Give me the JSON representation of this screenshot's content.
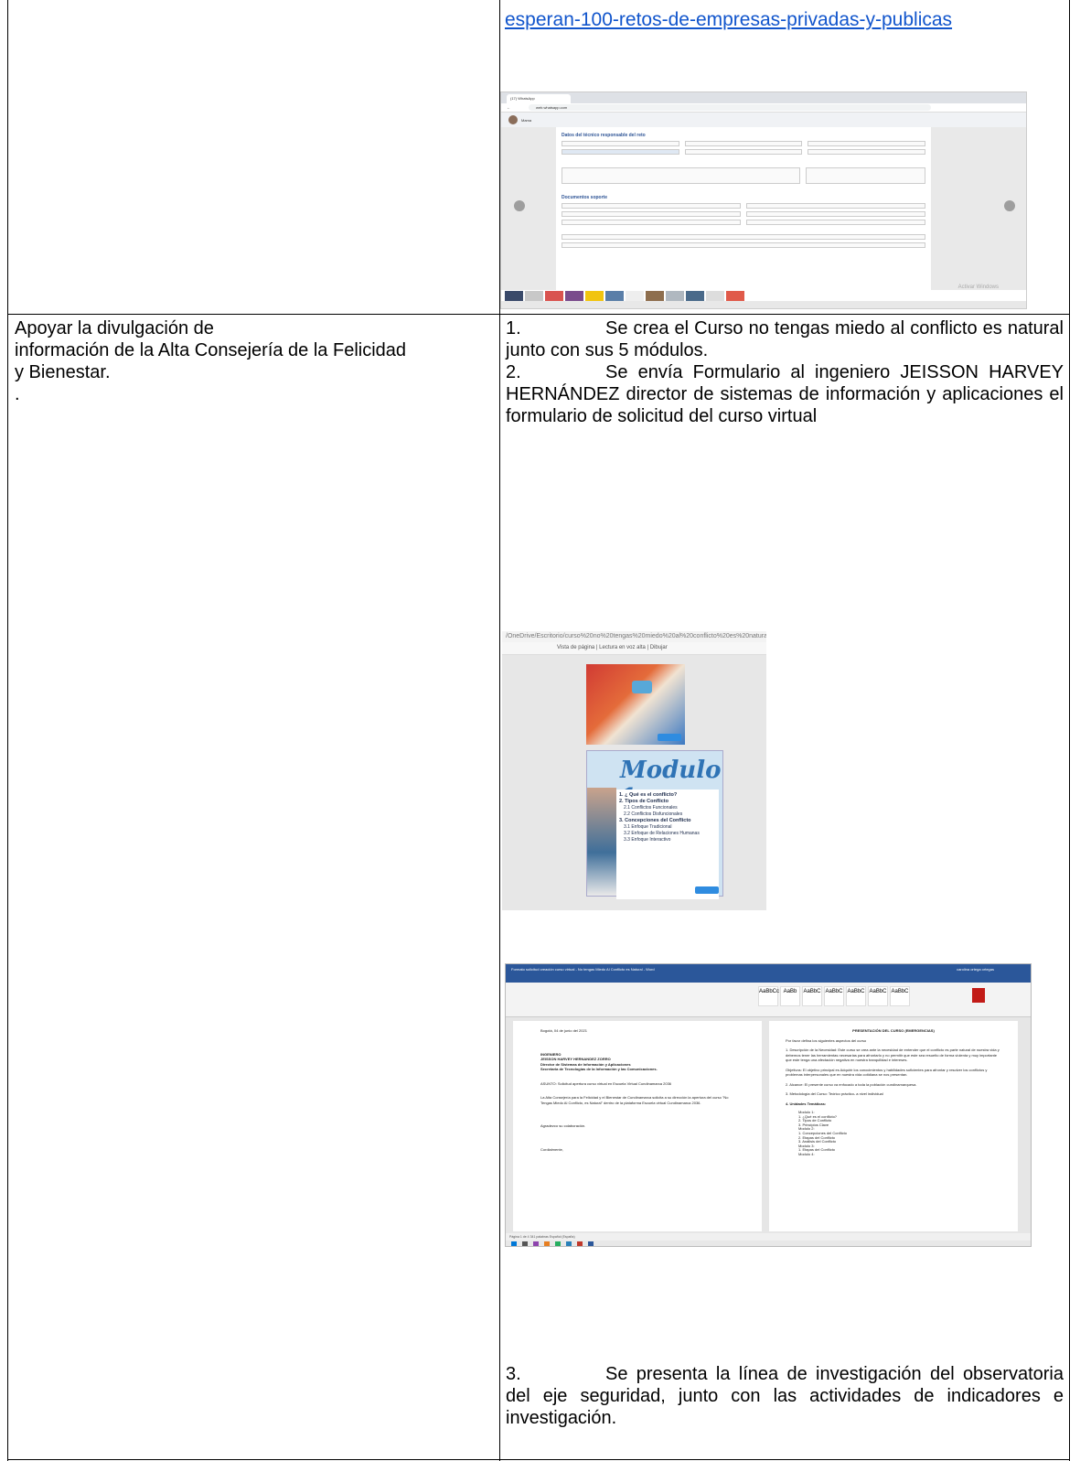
{
  "top_cell": {
    "link": "esperan-100-retos-de-empresas-privadas-y-publicas"
  },
  "screenshot_browser": {
    "tab_title": "(17) WhatsApp",
    "url": "web.whatsapp.com",
    "contact": "Mama",
    "form_heading_1": "Datos del técnico responsable del reto",
    "form_heading_2": "Documentos soporte",
    "watermark": "Activar Windows"
  },
  "left_cell": {
    "line1": "Apoyar la divulgación de",
    "line2": "información de la Alta Consejería de la Felicidad",
    "line3": "y Bienestar.",
    "line4": "."
  },
  "right_cell": {
    "item1_num": "1.",
    "item1_text": "Se crea el Curso no tengas miedo al conflicto es natural junto con sus 5 módulos.",
    "item2_num": "2.",
    "item2_text": "Se envía Formulario al ingeniero JEISSON HARVEY HERNÁNDEZ director de sistemas de información y aplicaciones el formulario de solicitud del curso virtual",
    "item3_num": "3.",
    "item3_text": "Se presenta la línea de investigación del observatoria del eje seguridad, junto con las actividades de indicadores e investigación."
  },
  "screenshot_module": {
    "path": "/OneDrive/Escritorio/curso%20no%20tengas%20miedo%20al%20conflicto%20es%20natural/modulos%20Capac%20-%20Cur",
    "toolbar": "Vista de página   |   Lectura en voz alta   |   Dibujar",
    "title": "Modulo 1",
    "items": [
      "1. ¿ Qué es el conflicto?",
      "2. Tipos de Conflicto",
      "2.1 Conflictos Funcionales",
      "2.2 Conflictos Disfuncionales",
      "3. Concepciones del Conflicto",
      "3.1 Enfoque Tradicional",
      "3.2 Enfoque de Relaciones Humanas",
      "3.3 Enfoque Interactivo"
    ]
  },
  "screenshot_word": {
    "title_bar": "Formato solicitud creación curso virtual - No tengas Miedo Al Conflicto es Natural - Word",
    "user": "carolina ortega ortegas",
    "left_page": {
      "date": "Bogotá, 04 de junio del 2021",
      "recipient": "INGENIERO\nJEISSON HARVEY HERNANDEZ ZORRO\nDirector de Sistemas de Información y Aplicaciones\nSecretaria de Tecnologías de la Información y las Comunicaciones.",
      "subject": "ASUNTO: Solicitud apertura curso virtual en Escuela Virtual Cundinamarca 2036",
      "body": "La Alta Consejería para la Felicidad y el Bienestar de Cundinamarca solicita a su dirección la apertura del curso \"No Tengas Miedo Al Conflicto, es Natural\" dentro de la plataforma Escuela virtual Cundinamarca 2036.",
      "thanks": "Agradezco su colaboración.",
      "closing": "Cordialmente,"
    },
    "right_page": {
      "heading": "PRESENTACIÓN DEL CURSO (EMERGENCIAS)",
      "intro": "Por favor defina los siguientes aspectos del curso",
      "need": "1. Descripción de la Necesidad: Este curso se crea ante la necesidad de entender que el conflicto es parte natural de nuestra vida y debemos tener las herramientas necesarias para afrontarlo y no permitir que este sea resuelto de forma violenta y muy importante que este tenga una afectación negativa en nuestra tranquilidad e intereses.",
      "objectives": "Objetivos: El objetivo principal es Adquirir los conocimientos y habilidades suficientes para afrontar y resolver los conflictos y problemas interpersonales que en nuestra vida cotidiana se nos presentan.",
      "scope": "2. Alcance: El presente curso va enfocado a toda la población cundinamarquesa.",
      "method": "3. Metodología del Curso: Teórico práctico- a nivel individual",
      "units": "4. Unidades Temáticas:",
      "units_list": "Modulo 1:\n1. ¿Qué es el conflicto?\n2. Tipos de Conflicto\n3. Principios Clave\nModulo 2:\n1. Concepciones del Conflicto\n2. Etapas del Conflicto\n3. Análisis del Conflicto\nModulo 3:\n1. Etapas del Conflicto\nModulo 4:"
    },
    "status": "Página 1 de 4   341 palabras   Español (España)"
  }
}
